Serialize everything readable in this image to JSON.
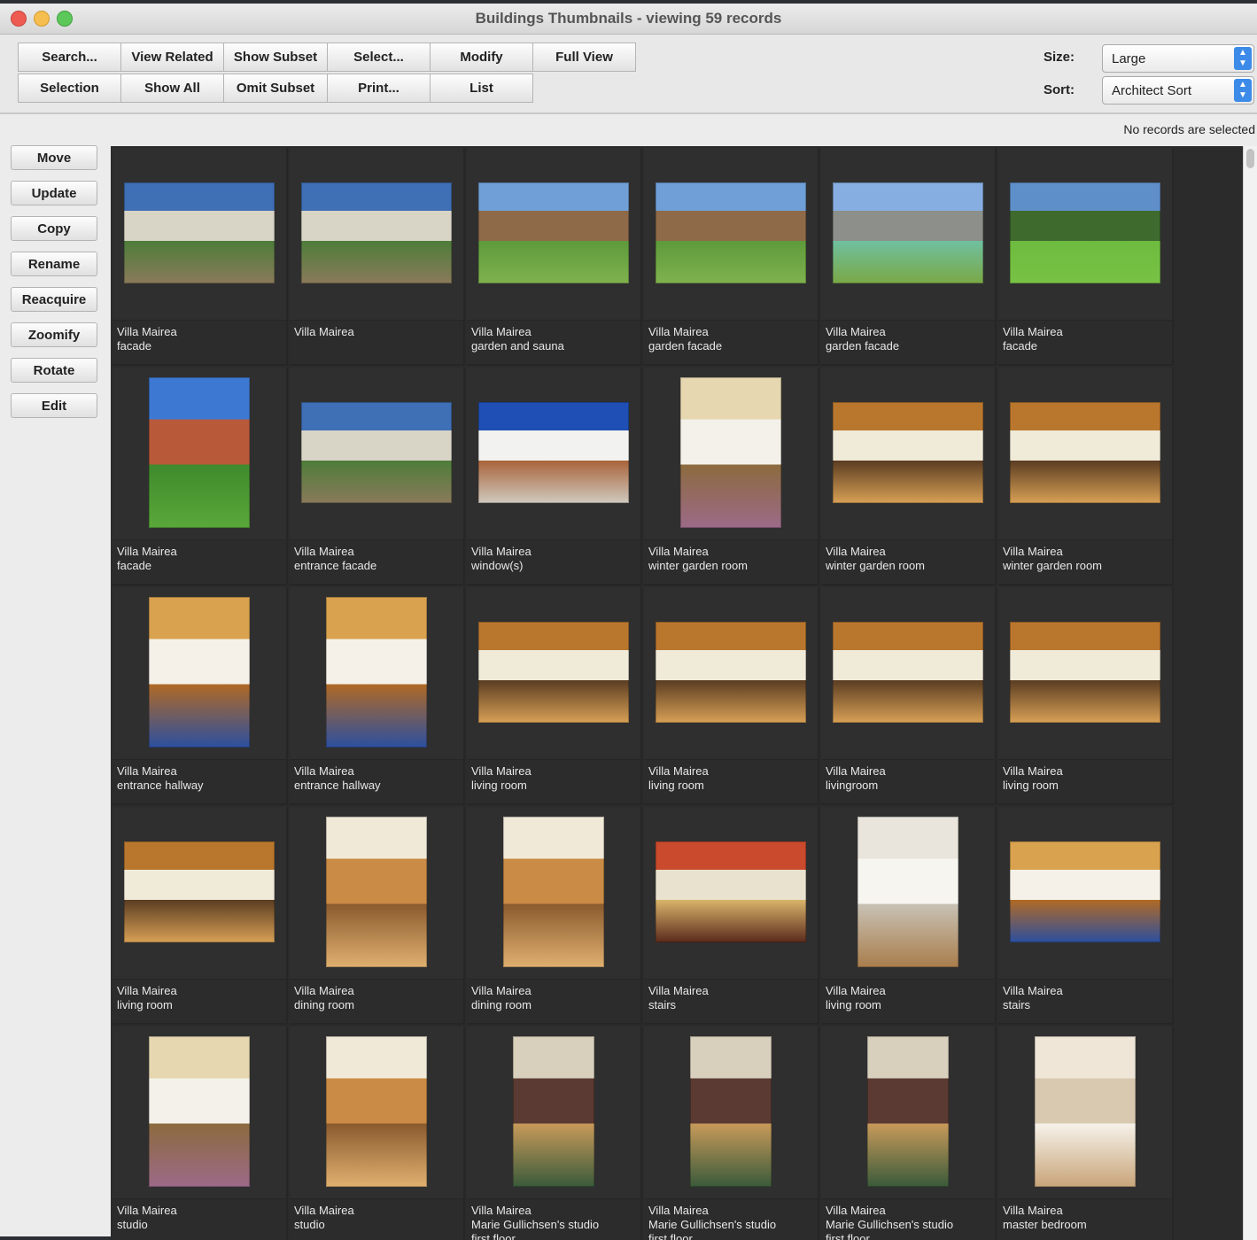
{
  "window": {
    "title": "Buildings Thumbnails - viewing 59 records"
  },
  "toolbar": {
    "row1": [
      "Search...",
      "View Related",
      "Show Subset",
      "Select...",
      "Modify",
      "Full View"
    ],
    "row2": [
      "Selection",
      "Show All",
      "Omit Subset",
      "Print...",
      "List"
    ],
    "size_label": "Size:",
    "size_value": "Large",
    "sort_label": "Sort:",
    "sort_value": "Architect Sort"
  },
  "status": "No records are selected",
  "sidebar": [
    "Move",
    "Update",
    "Copy",
    "Rename",
    "Reacquire",
    "Zoomify",
    "Rotate",
    "Edit"
  ],
  "records": [
    {
      "caption": [
        "Villa Mairea",
        "facade"
      ],
      "shape": "landscape",
      "theme": "exterior-forest"
    },
    {
      "caption": [
        "Villa Mairea"
      ],
      "shape": "landscape",
      "theme": "exterior-forest"
    },
    {
      "caption": [
        "Villa Mairea",
        "garden and sauna"
      ],
      "shape": "landscape",
      "theme": "exterior-garden"
    },
    {
      "caption": [
        "Villa Mairea",
        "garden facade"
      ],
      "shape": "landscape",
      "theme": "exterior-garden"
    },
    {
      "caption": [
        "Villa Mairea",
        "garden facade"
      ],
      "shape": "landscape",
      "theme": "exterior-pool"
    },
    {
      "caption": [
        "Villa Mairea",
        "facade"
      ],
      "shape": "landscape",
      "theme": "exterior-lawn"
    },
    {
      "caption": [
        "Villa Mairea",
        "facade"
      ],
      "shape": "portrait",
      "theme": "exterior-tree"
    },
    {
      "caption": [
        "Villa Mairea",
        "entrance facade"
      ],
      "shape": "landscape",
      "theme": "exterior-forest"
    },
    {
      "caption": [
        "Villa Mairea",
        "window(s)"
      ],
      "shape": "landscape",
      "theme": "exterior-white"
    },
    {
      "caption": [
        "Villa Mairea",
        "winter garden room"
      ],
      "shape": "portrait",
      "theme": "interior-light"
    },
    {
      "caption": [
        "Villa Mairea",
        "winter garden room"
      ],
      "shape": "landscape",
      "theme": "interior-wood"
    },
    {
      "caption": [
        "Villa Mairea",
        "winter garden room"
      ],
      "shape": "landscape",
      "theme": "interior-wood"
    },
    {
      "caption": [
        "Villa Mairea",
        "entrance hallway"
      ],
      "shape": "portrait",
      "theme": "interior-poles"
    },
    {
      "caption": [
        "Villa Mairea",
        "entrance hallway"
      ],
      "shape": "portrait",
      "theme": "interior-poles"
    },
    {
      "caption": [
        "Villa Mairea",
        "living room"
      ],
      "shape": "landscape",
      "theme": "interior-wood"
    },
    {
      "caption": [
        "Villa Mairea",
        "living room"
      ],
      "shape": "landscape",
      "theme": "interior-wood"
    },
    {
      "caption": [
        "Villa Mairea",
        "livingroom"
      ],
      "shape": "landscape",
      "theme": "interior-wood"
    },
    {
      "caption": [
        "Villa Mairea",
        "living room"
      ],
      "shape": "landscape",
      "theme": "interior-wood"
    },
    {
      "caption": [
        "Villa Mairea",
        "living room"
      ],
      "shape": "landscape",
      "theme": "interior-wood"
    },
    {
      "caption": [
        "Villa Mairea",
        "dining room"
      ],
      "shape": "portrait",
      "theme": "interior-dining"
    },
    {
      "caption": [
        "Villa Mairea",
        "dining room"
      ],
      "shape": "portrait",
      "theme": "interior-dining"
    },
    {
      "caption": [
        "Villa Mairea",
        "stairs"
      ],
      "shape": "landscape",
      "theme": "interior-stairs"
    },
    {
      "caption": [
        "Villa Mairea",
        "living room"
      ],
      "shape": "portrait",
      "theme": "interior-white"
    },
    {
      "caption": [
        "Villa Mairea",
        "stairs"
      ],
      "shape": "landscape",
      "theme": "interior-poles"
    },
    {
      "caption": [
        "Villa Mairea",
        "studio"
      ],
      "shape": "portrait",
      "theme": "interior-light"
    },
    {
      "caption": [
        "Villa Mairea",
        "studio"
      ],
      "shape": "portrait",
      "theme": "interior-dining"
    },
    {
      "caption": [
        "Villa Mairea",
        "Marie Gullichsen's studio",
        "first floor"
      ],
      "shape": "tall",
      "theme": "interior-studio"
    },
    {
      "caption": [
        "Villa Mairea",
        "Marie Gullichsen's studio",
        "first floor"
      ],
      "shape": "tall",
      "theme": "interior-studio"
    },
    {
      "caption": [
        "Villa Mairea",
        "Marie Gullichsen's studio",
        "first floor"
      ],
      "shape": "tall",
      "theme": "interior-studio"
    },
    {
      "caption": [
        "Villa Mairea",
        "master bedroom"
      ],
      "shape": "portrait",
      "theme": "interior-bedroom"
    }
  ]
}
